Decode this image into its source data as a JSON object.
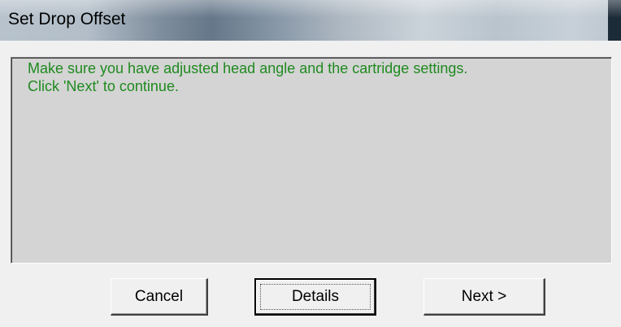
{
  "window": {
    "title": "Set Drop Offset"
  },
  "message": {
    "line1": "Make sure you have adjusted head angle and the cartridge settings.",
    "line2": "Click 'Next' to continue.",
    "text_color": "#1f8a1f"
  },
  "buttons": {
    "cancel_label": "Cancel",
    "details_label": "Details",
    "next_label": "Next >"
  }
}
